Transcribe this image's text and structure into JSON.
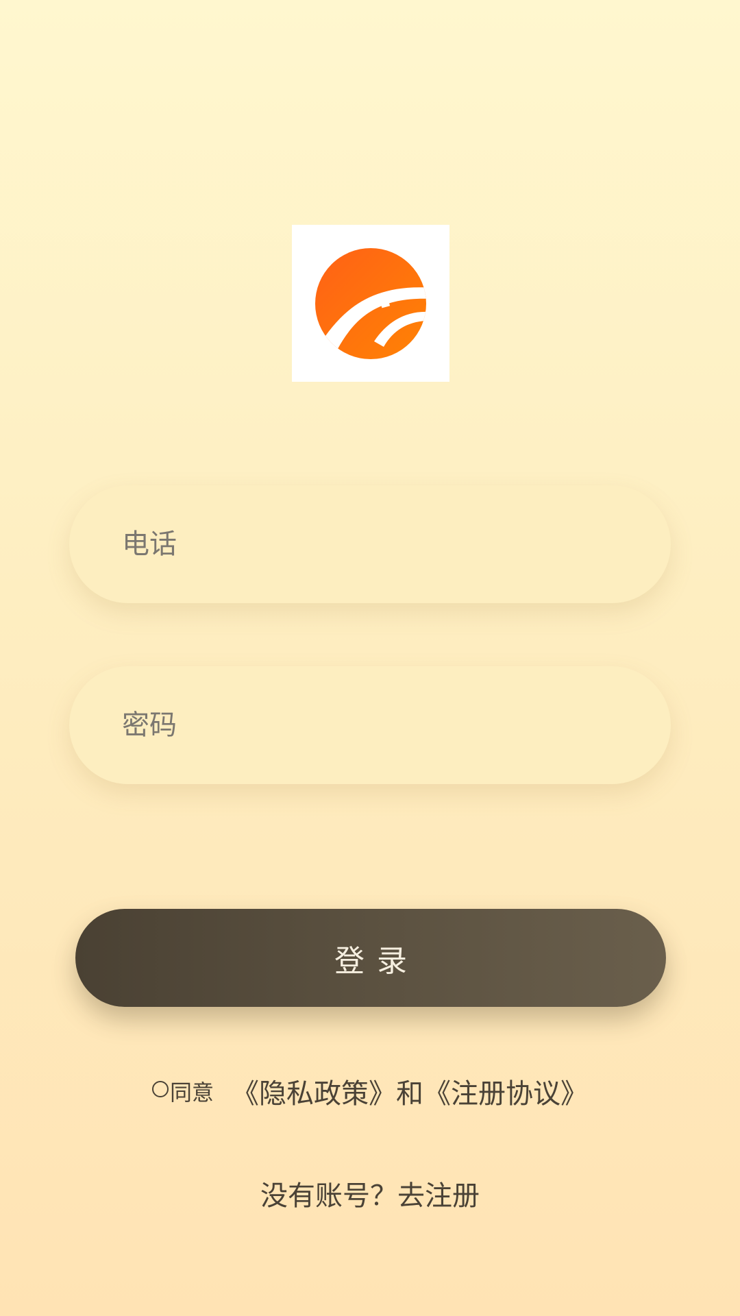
{
  "logo": {
    "icon": "brand-logo-icon",
    "colors": {
      "primary": "#ff6a13",
      "secondary": "#ff8a00",
      "background": "#ffffff"
    }
  },
  "form": {
    "phone_placeholder": "电话",
    "password_placeholder": "密码",
    "login_label": "登录"
  },
  "agreement": {
    "agree_label": "同意",
    "privacy_link": "《隐私政策》",
    "and_text": "和",
    "terms_link": "《注册协议》",
    "checked": false
  },
  "register": {
    "text": "没有账号？去注册"
  },
  "colors": {
    "background_top": "#fff7cf",
    "background_bottom": "#ffe3b4",
    "field_background": "#fdeec0",
    "button_background": "#5b5140",
    "button_text": "#f6efe0",
    "text": "#4a4236"
  }
}
